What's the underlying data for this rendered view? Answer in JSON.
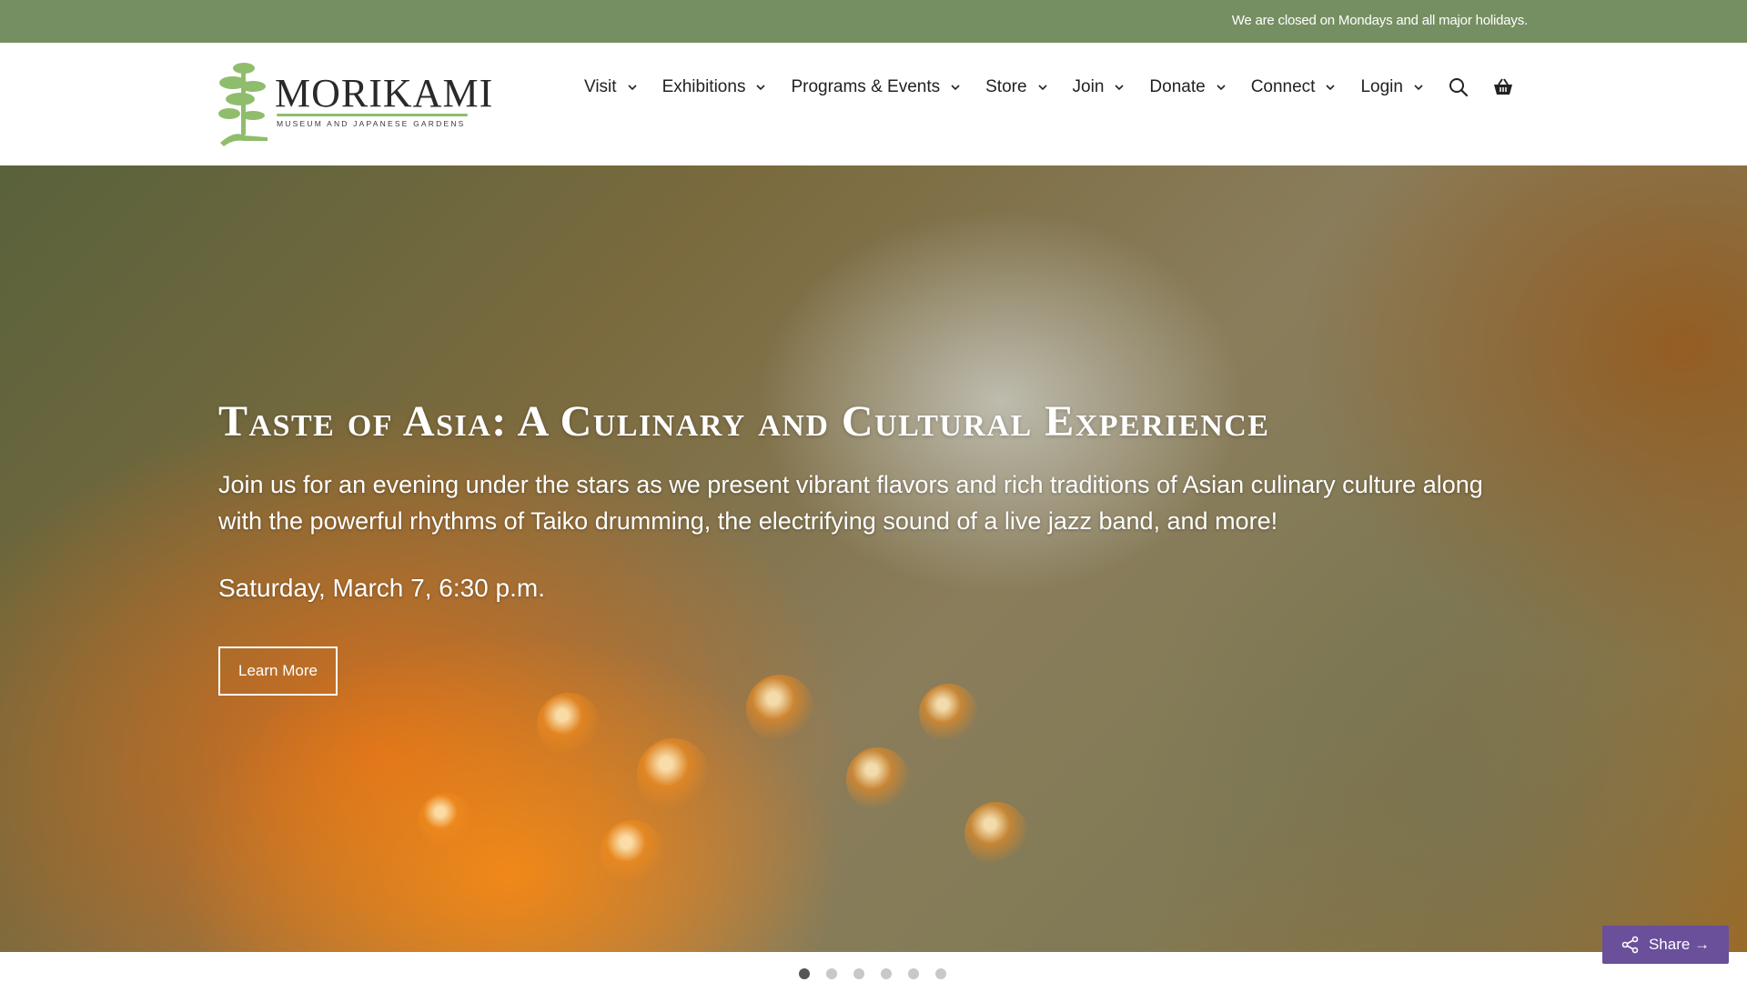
{
  "topbar": {
    "notice": "We are closed on Mondays and all major holidays."
  },
  "logo": {
    "name": "MORIKAMI",
    "subtitle": "MUSEUM AND JAPANESE GARDENS"
  },
  "nav": {
    "items": [
      {
        "label": "Visit"
      },
      {
        "label": "Exhibitions"
      },
      {
        "label": "Programs & Events"
      },
      {
        "label": "Store"
      },
      {
        "label": "Join"
      },
      {
        "label": "Donate"
      },
      {
        "label": "Connect"
      },
      {
        "label": "Login"
      }
    ],
    "icons": [
      "search-icon",
      "basket-icon"
    ]
  },
  "hero": {
    "title": "Taste of Asia: A Culinary and Cultural Experience",
    "description": "Join us for an evening under the stars as we present vibrant flavors and rich traditions of Asian culinary culture along with the powerful rhythms of Taiko drumming, the electrifying sound of a live jazz band, and more!",
    "date": "Saturday, March 7, 6:30 p.m.",
    "button_label": "Learn More"
  },
  "carousel": {
    "slide_count": 6,
    "active_slide": 1
  },
  "share": {
    "label": "Share →"
  },
  "colors": {
    "topbar": "#758f62",
    "share": "#6a4f9a",
    "logo_green": "#8fbd6c"
  }
}
